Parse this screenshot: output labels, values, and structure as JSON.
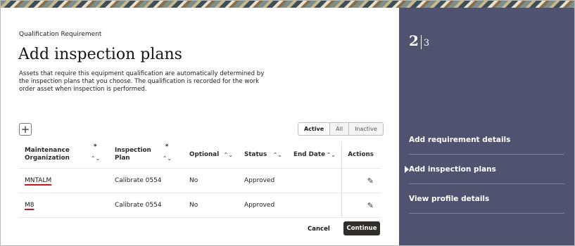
{
  "eyebrow": "Qualification Requirement",
  "title": "Add inspection plans",
  "description": "Assets that require this equipment qualification are automatically determined by the inspection plans that you choose. The qualification is recorded for the work order asset when inspection is performed.",
  "add_icon": "+",
  "filter": {
    "active": "Active",
    "all": "All",
    "inactive": "Inactive"
  },
  "table": {
    "headers": {
      "maintenance_organization": "Maintenance Organization",
      "inspection_plan": "Inspection Plan",
      "optional": "Optional",
      "status": "Status",
      "end_date": "End Date",
      "actions": "Actions",
      "required_mark": "*",
      "sort_icon": "⌃⌄"
    },
    "rows": [
      {
        "org": "MNTALM",
        "plan": "Calibrate 0554",
        "optional": "No",
        "status": "Approved",
        "end_date": ""
      },
      {
        "org": "M8",
        "plan": "Calibrate 0554",
        "optional": "No",
        "status": "Approved",
        "end_date": ""
      }
    ],
    "edit_icon": "✎"
  },
  "buttons": {
    "cancel": "Cancel",
    "continue": "Continue"
  },
  "side": {
    "step_current": "2",
    "step_total": "3",
    "items": [
      {
        "label": "Add requirement details"
      },
      {
        "label": "Add inspection plans"
      },
      {
        "label": "View profile details"
      }
    ]
  }
}
